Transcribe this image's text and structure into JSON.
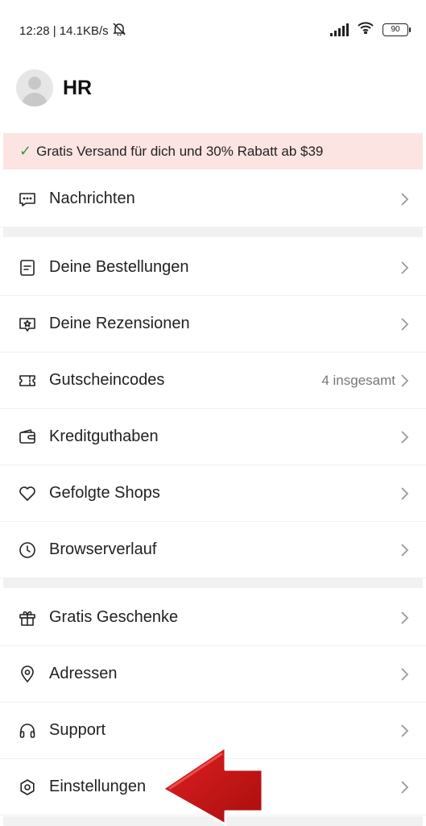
{
  "status_bar": {
    "time": "12:28 | 14.1KB/s",
    "battery": "90"
  },
  "profile": {
    "name": "HR"
  },
  "promo": {
    "text": "Gratis Versand für dich und 30% Rabatt ab $39"
  },
  "menu": [
    {
      "label": "Nachrichten",
      "icon": "message-icon"
    },
    {
      "label": "Deine Bestellungen",
      "icon": "orders-icon"
    },
    {
      "label": "Deine Rezensionen",
      "icon": "reviews-icon"
    },
    {
      "label": "Gutscheincodes",
      "icon": "coupon-icon",
      "extra": "4 insgesamt"
    },
    {
      "label": "Kreditguthaben",
      "icon": "wallet-icon"
    },
    {
      "label": "Gefolgte Shops",
      "icon": "heart-icon"
    },
    {
      "label": "Browserverlauf",
      "icon": "clock-icon"
    },
    {
      "label": "Gratis Geschenke",
      "icon": "gift-icon"
    },
    {
      "label": "Adressen",
      "icon": "location-icon"
    },
    {
      "label": "Support",
      "icon": "headset-icon"
    },
    {
      "label": "Einstellungen",
      "icon": "settings-icon"
    }
  ],
  "colors": {
    "promo_bg": "#fbe4e2",
    "check": "#2e9a3a",
    "arrow": "#d01818"
  }
}
